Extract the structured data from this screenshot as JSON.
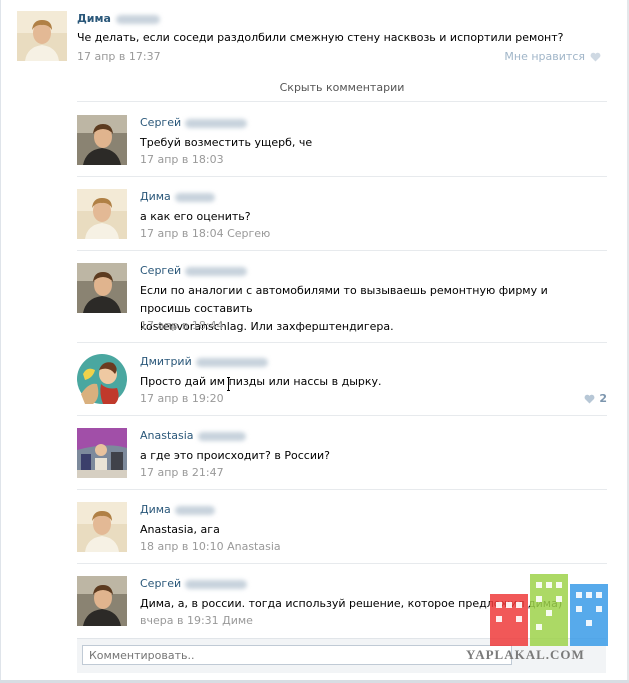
{
  "post": {
    "author": "Дима",
    "text": "Че делать, если соседи раздолбили смежную стену насквозь и испортили ремонт?",
    "time": "17 апр в 17:37",
    "like_label": "Мне нравится"
  },
  "hide_comments": "Скрыть комментарии",
  "comments": [
    {
      "author": "Сергей",
      "lines": [
        "Требуй возместить ущерб, че"
      ],
      "meta": "17 апр в 18:03"
    },
    {
      "author": "Дима",
      "lines": [
        "а как его оценить?"
      ],
      "meta": "17 апр в 18:04 Сергею"
    },
    {
      "author": "Сергей",
      "lines": [
        "Если по аналогии с автомобилями то вызываешь ремонтную фирму и просишь составить",
        "kostenvoranschlag. Или захферштендигера."
      ],
      "meta": "17 апр в 18:44"
    },
    {
      "author": "Дмитрий",
      "lines": [
        "Просто дай им пизды или нассы в дырку."
      ],
      "meta": "17 апр в 19:20",
      "likes": "2"
    },
    {
      "author": "Anastasia",
      "lines": [
        "а где это происходит? в России?"
      ],
      "meta": "17 апр в 21:47"
    },
    {
      "author": "Дима",
      "lines": [
        "Anastasia, ага"
      ],
      "meta": "18 апр в 10:10 Anastasia"
    },
    {
      "author": "Сергей",
      "lines": [
        "Дима, а, в россии. тогда используй решение, которое предложил дима)"
      ],
      "meta": "вчера в 19:31 Диме"
    }
  ],
  "comment_input": {
    "placeholder": "Комментировать.."
  },
  "watermark": "YAPLAKAL.COM"
}
